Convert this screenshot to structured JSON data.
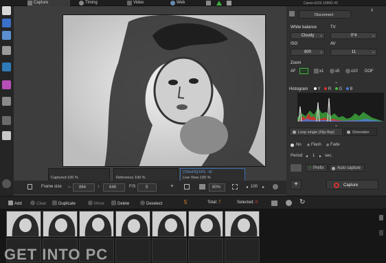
{
  "tabs": [
    {
      "label": "Capture",
      "icon": "camera-icon",
      "active": true
    },
    {
      "label": "Timing",
      "icon": "timer-icon",
      "active": false
    },
    {
      "label": "Video",
      "icon": "video-icon",
      "active": false
    },
    {
      "label": "Web",
      "icon": "globe-icon",
      "active": false
    }
  ],
  "camera": {
    "name": "Canon EOS 1000D #0",
    "disconnect_label": "Disconnect"
  },
  "settings": {
    "white_balance_label": "White balance",
    "white_balance_value": "Cloudy",
    "tv_label": "TV",
    "tv_value": "0\"4",
    "iso_label": "ISO",
    "iso_value": "800",
    "av_label": "AV",
    "av_value": "11"
  },
  "zoom": {
    "label": "Zoom",
    "af_label": "AF",
    "x1": "x1",
    "x5": "x5",
    "x10": "x10",
    "dof": "DOF"
  },
  "histogram": {
    "label": "Histogram",
    "channels": [
      "Y",
      "R",
      "G",
      "B"
    ],
    "channel_colors": [
      "#ffffff",
      "#e53030",
      "#40c040",
      "#4a7ad8"
    ]
  },
  "loop": {
    "tab_label": "Loop single (Flip-flop)",
    "onion_label": "Onionskin",
    "no": "No",
    "flash": "Flash",
    "fade": "Fade",
    "period_label": "Period",
    "period_value": "1",
    "period_unit": "sec."
  },
  "capture_opts": {
    "prefix": "Prefix",
    "auto_capture": "Auto capture",
    "capture_label": "Capture"
  },
  "panels": {
    "captured_label": "Captured",
    "captured_value": "100 %",
    "reference_label": "Reference",
    "reference_value": "100 %",
    "live_header": "[720x470] FPS : 42",
    "live_label": "Live View",
    "live_value": "100 %",
    "captured_level": 1.0,
    "reference_level": 1.0,
    "live_level": 1.0
  },
  "framebar": {
    "frame_size_label": "Frame size",
    "width": "864",
    "height": "648",
    "fps_label": "F/S",
    "fps": "9",
    "zoom": "80%",
    "count": "100"
  },
  "actions": {
    "add": "Add",
    "clear": "Clear",
    "duplicate": "Duplicate",
    "move": "Move",
    "delete": "Delete",
    "deselect": "Deselect",
    "current": "5",
    "total_label": "Total:",
    "total_value": "7",
    "selected_label": "Selected:",
    "selected_value": "0"
  },
  "watermark": "GET INTO PC"
}
